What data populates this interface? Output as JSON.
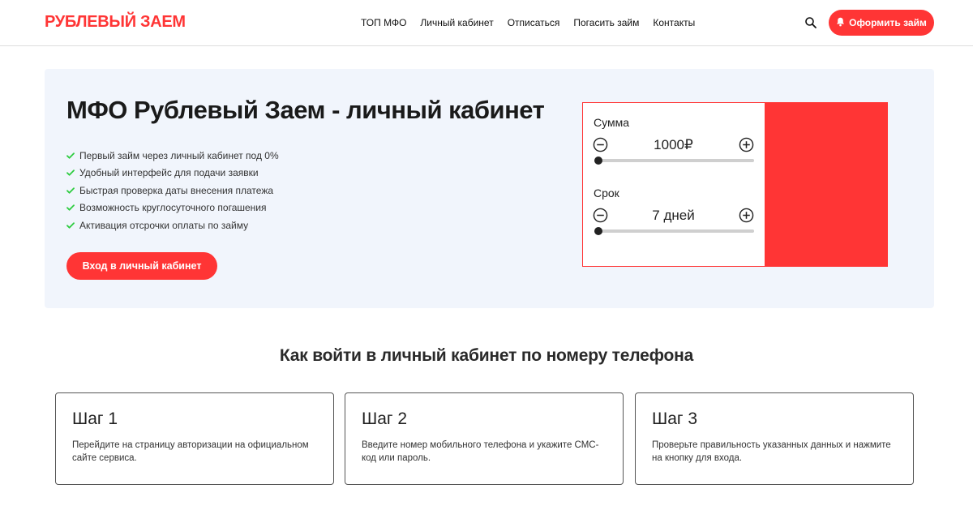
{
  "header": {
    "logo": "РУБЛЕВЫЙ ЗАЕМ",
    "nav": [
      "ТОП МФО",
      "Личный кабинет",
      "Отписаться",
      "Погасить займ",
      "Контакты"
    ],
    "search_icon": "search-icon",
    "cta_label": "Оформить займ",
    "cta_icon": "bell-icon"
  },
  "hero": {
    "title": "МФО Рублевый Заем - личный кабинет",
    "features": [
      "Первый займ через личный кабинет под 0%",
      "Удобный интерфейс для подачи заявки",
      "Быстрая проверка даты внесения платежа",
      "Возможность круглосуточного погашения",
      "Активация отсрочки оплаты по займу"
    ],
    "login_button": "Вход в личный кабинет"
  },
  "calculator": {
    "amount_label": "Сумма",
    "amount_value": "1000₽",
    "amount_fraction": 0,
    "term_label": "Срок",
    "term_value": "7 дней",
    "term_fraction": 0
  },
  "steps_section": {
    "title": "Как войти в личный кабинет по номеру телефона",
    "steps": [
      {
        "title": "Шаг 1",
        "text": "Перейдите на страницу авторизации на официальном сайте сервиса."
      },
      {
        "title": "Шаг 2",
        "text": "Введите номер мобильного телефона и укажите СМС-код или пароль."
      },
      {
        "title": "Шаг 3",
        "text": "Проверьте правильность указанных данных и нажмите на кнопку для входа."
      }
    ]
  },
  "colors": {
    "accent": "#ff3535",
    "hero_bg": "#f1f5fc",
    "check": "#2ecc40"
  }
}
